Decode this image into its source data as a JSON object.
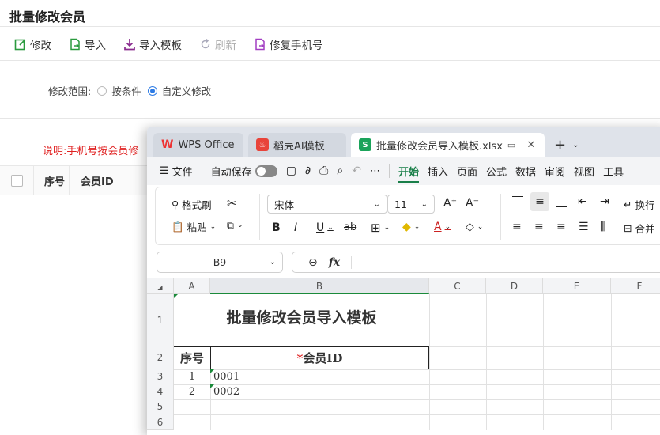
{
  "page": {
    "title": "批量修改会员"
  },
  "toolbar": {
    "edit": "修改",
    "import": "导入",
    "import_template": "导入模板",
    "refresh": "刷新",
    "fix_phone": "修复手机号"
  },
  "range": {
    "label": "修改范围:",
    "option1": "按条件",
    "option2": "自定义修改",
    "selected": "自定义修改"
  },
  "note": "说明:手机号按会员修",
  "table": {
    "columns": [
      "序号",
      "会员ID"
    ]
  },
  "wps": {
    "tabs": [
      {
        "label": "WPS Office"
      },
      {
        "label": "稻壳AI模板"
      },
      {
        "label": "批量修改会员导入模板.xlsx"
      }
    ],
    "menu": {
      "file": "文件",
      "autosave": "自动保存",
      "items": [
        "开始",
        "插入",
        "页面",
        "公式",
        "数据",
        "审阅",
        "视图",
        "工具"
      ]
    },
    "ribbon": {
      "format_painter": "格式刷",
      "paste": "粘贴",
      "font": "宋体",
      "size": "11",
      "wrap": "换行",
      "merge": "合并"
    },
    "namebox": "B9",
    "fx": "fx",
    "columns": [
      "A",
      "B",
      "C",
      "D",
      "E",
      "F"
    ],
    "rows": [
      "1",
      "2",
      "3",
      "4",
      "5",
      "6"
    ],
    "sheet": {
      "title": "批量修改会员导入模板",
      "header_no": "序号",
      "header_id_star": "*",
      "header_id": "会员ID",
      "data": [
        {
          "no": "1",
          "id": "0001"
        },
        {
          "no": "2",
          "id": "0002"
        }
      ]
    }
  },
  "colors": {
    "accent": "#1a7f49",
    "note": "#e02020",
    "radio": "#2d7be5"
  }
}
